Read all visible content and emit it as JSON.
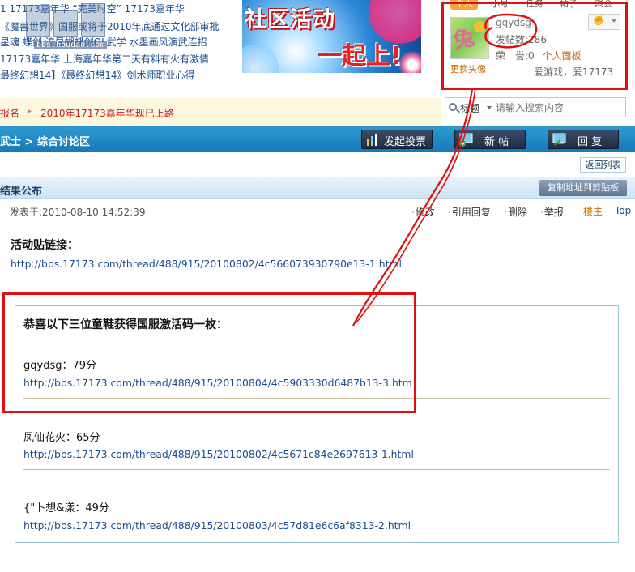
{
  "news": {
    "lines": [
      "1 17173嘉年华 “完美时空” 17173嘉年华",
      "《魔兽世界》国服或将于2010年底通过文化部审批",
      "星魂 蝶剑 流星蝴蝶剑OL武学 水墨画风演武连招",
      "17173嘉年华 上海嘉年华第二天有料有火有激情",
      "最终幻想14】《最终幻想14》剑术师职业心得"
    ],
    "watermark_url": "bbs.houdao.com"
  },
  "banner": {
    "text_line1": "社区活动",
    "text_line2": "一起上!"
  },
  "user_panel": {
    "tabs": [
      "个人",
      "小号",
      "任务",
      "帖子",
      "聚会"
    ],
    "username": "gqydsg",
    "posts_label": "发帖数:",
    "posts_count": "286",
    "rep_label": "荣　誉:",
    "rep_value": "0",
    "profile_link": "个人面板",
    "change_avatar": "更换头像",
    "signature": "爱游戏，爱17173",
    "medal_icon": "medal-icon"
  },
  "announcement": {
    "item1": "报名",
    "item2": "2010年17173嘉年华现已上路"
  },
  "search": {
    "type_label": "标题",
    "placeholder": "请输入搜索内容"
  },
  "toolbar": {
    "breadcrumb": "武士 > 综合讨论区",
    "vote_label": "发起投票",
    "new_post_label": "新 帖",
    "reply_label": "回 复"
  },
  "list_nav": {
    "return_label": "返回列表"
  },
  "post": {
    "title": "结果公布",
    "copy_label": "复制地址到剪贴板",
    "date": "发表于:2010-08-10 14:52:39",
    "actions": [
      "修改",
      "引用回复",
      "删除",
      "举报"
    ],
    "floor": "楼主",
    "top_label": "Top",
    "heading1": "活动贴链接：",
    "link1": "http://bbs.17173.com/thread/488/915/20100802/4c566073930790e13-1.html",
    "quote_heading": "恭喜以下三位童鞋获得国服激活码一枚：",
    "winners": [
      {
        "name": "gqydsg：79分",
        "link": "http://bbs.17173.com/thread/488/915/20100804/4c5903330d6487b13-3.htm"
      },
      {
        "name": "凤仙花火：65分",
        "link": "http://bbs.17173.com/thread/488/915/20100802/4c5671c84e2697613-1.html"
      },
      {
        "name": "{\"卜想&漾：49分",
        "link": "http://bbs.17173.com/thread/488/915/20100803/4c57d81e6c6af8313-2.html"
      }
    ]
  },
  "colors": {
    "toolbar_blue": "#1f86c4",
    "annotation_red": "#e01010",
    "link_blue": "#1a4d8f"
  }
}
